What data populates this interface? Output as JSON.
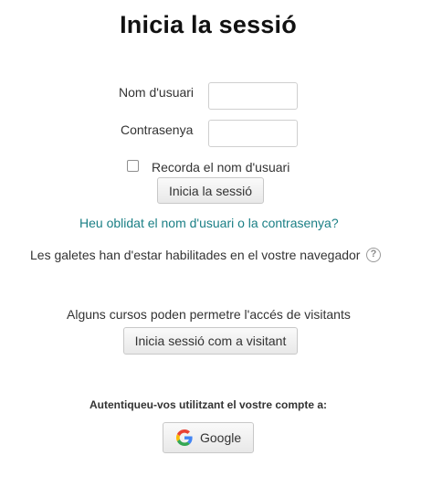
{
  "page": {
    "title": "Inicia la sessió"
  },
  "login_form": {
    "username_label": "Nom d'usuari",
    "username_value": "",
    "password_label": "Contrasenya",
    "password_value": "",
    "remember_label": "Recorda el nom d'usuari",
    "remember_checked": false,
    "submit_label": "Inicia la sessió",
    "forgot_link": "Heu oblidat el nom d'usuari o la contrasenya?"
  },
  "cookies_notice": {
    "text": "Les galetes han d'estar habilitades en el vostre navegador",
    "icon": "help-icon"
  },
  "guest": {
    "text": "Alguns cursos poden permetre l'accés de visitants",
    "button_label": "Inicia sessió com a visitant"
  },
  "identity_providers": {
    "heading": "Autentiqueu-vos utilitzant el vostre compte a:",
    "providers": [
      {
        "label": "Google",
        "icon": "google-icon"
      }
    ]
  },
  "colors": {
    "link": "#1a7f85",
    "text": "#333333",
    "title": "#111111"
  }
}
